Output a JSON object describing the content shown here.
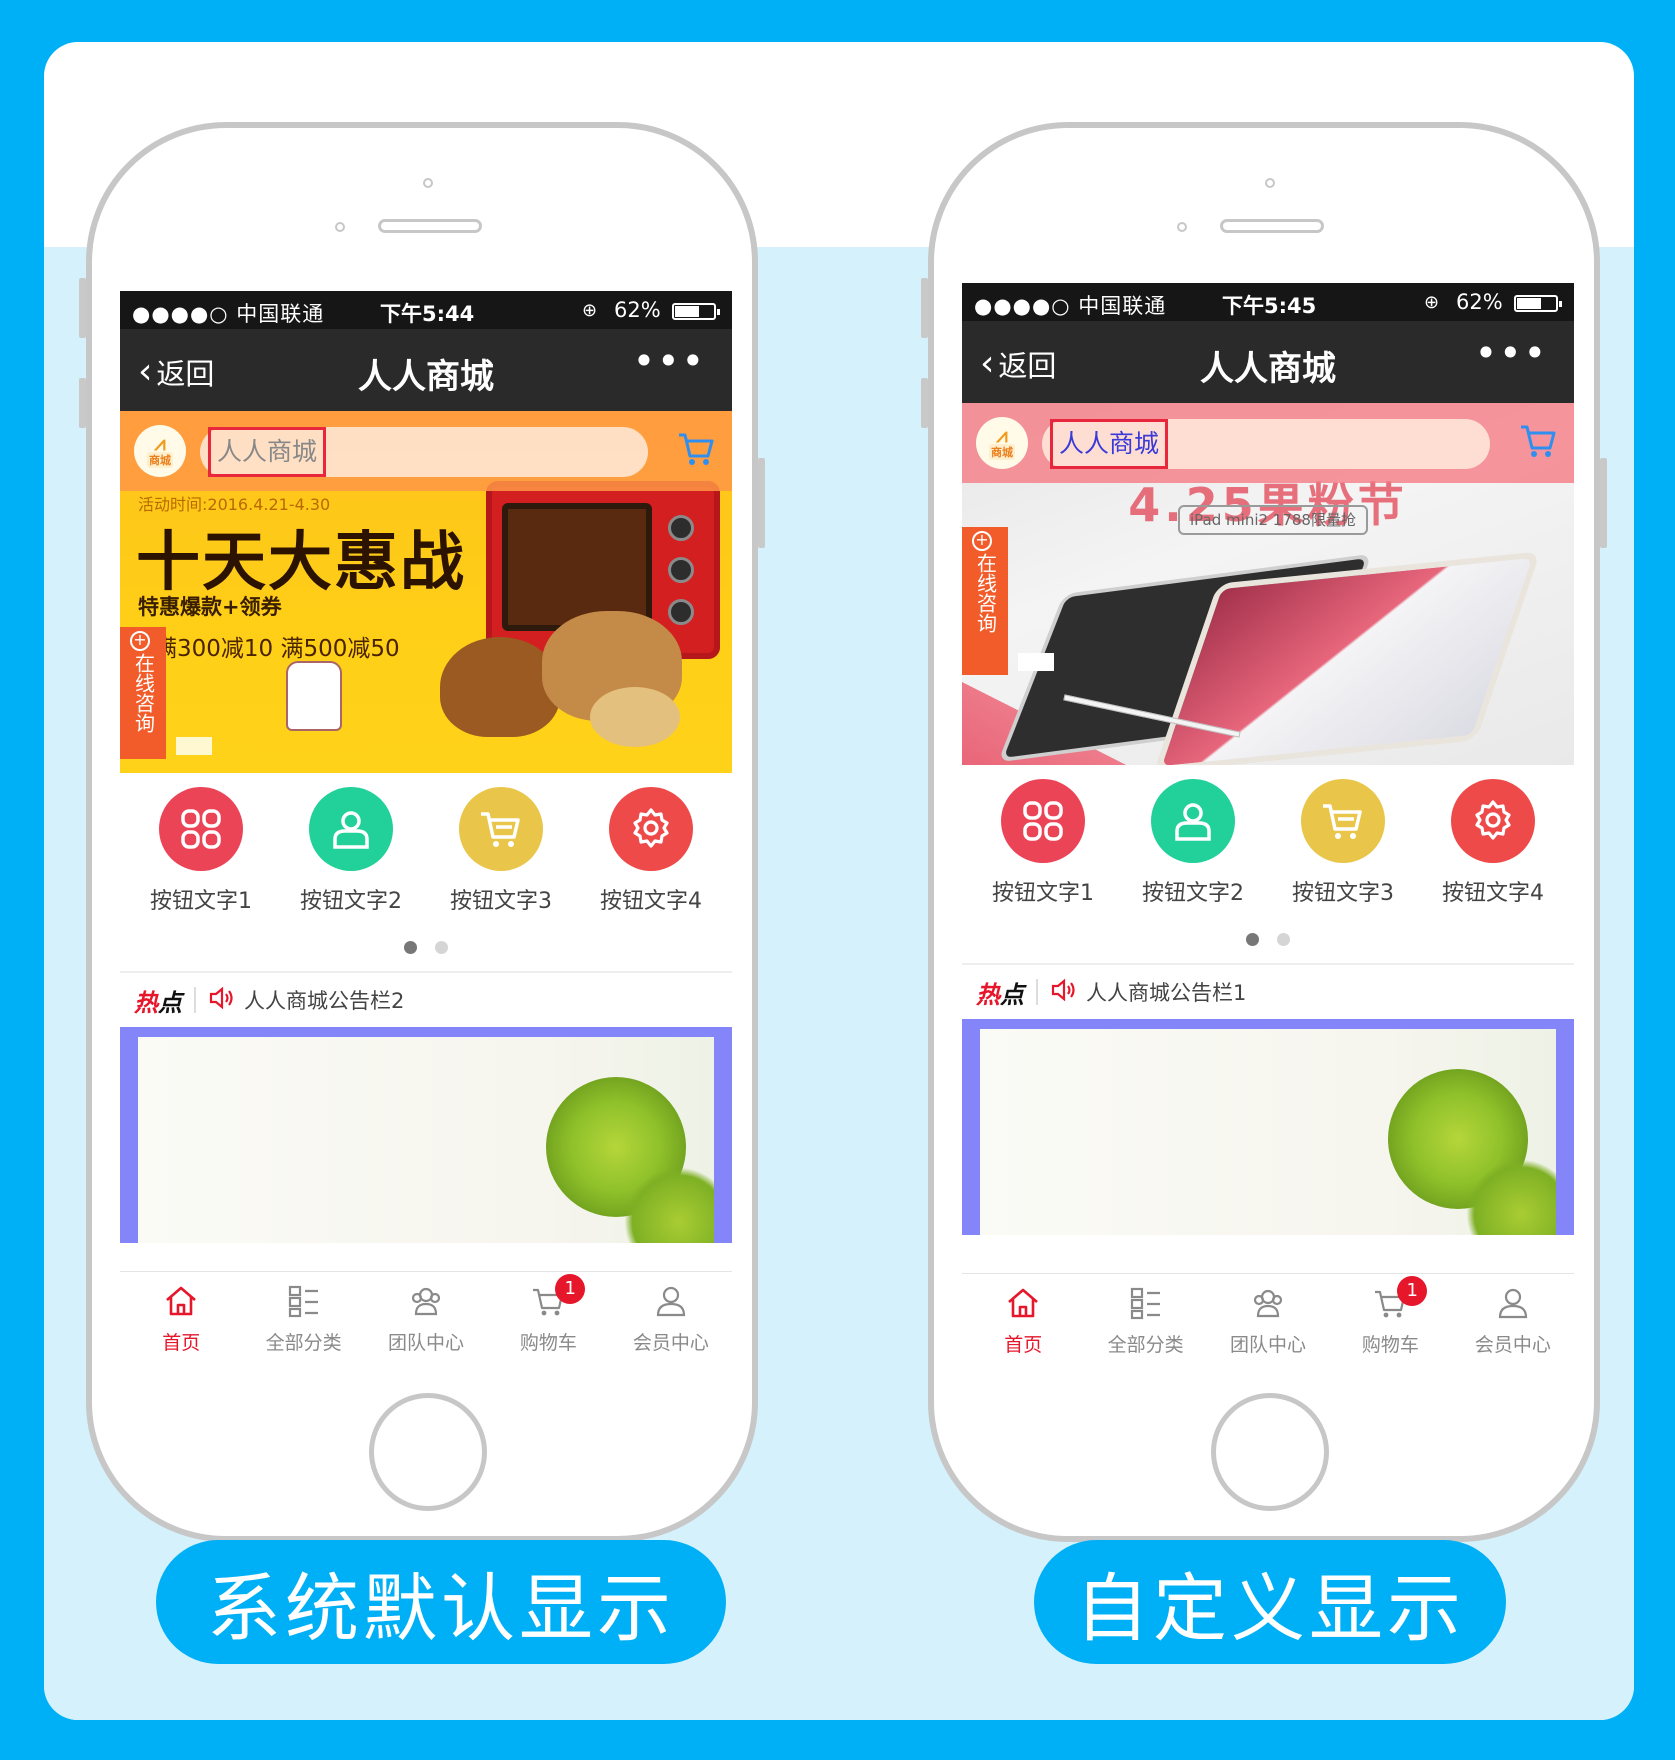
{
  "colors": {
    "frame_blue": "#00b0f6",
    "light_blue": "#d5f1fc",
    "accent_red": "#e6162b",
    "btn1": "#ec4457",
    "btn2": "#22d19a",
    "btn3": "#e9c64a",
    "btn4": "#ee4a4a"
  },
  "phones": [
    {
      "status": {
        "signal": "●●●●○ 中国联通",
        "time": "下午5:44",
        "battery": "62%"
      },
      "nav": {
        "back": "返回",
        "title": "人人商城",
        "more": "•••"
      },
      "search": {
        "text": "人人商城"
      },
      "banner": {
        "date": "活动时间:2016.4.21-4.30",
        "title": "十天大惠战",
        "subtitle": "特惠爆款+领券",
        "offer": "满300减10 满500减50"
      },
      "consult": "在线咨询",
      "buttons": [
        "按钮文字1",
        "按钮文字2",
        "按钮文字3",
        "按钮文字4"
      ],
      "notice": {
        "hot": "热",
        "dian": "点",
        "text": "人人商城公告栏2"
      },
      "tabs": [
        "首页",
        "全部分类",
        "团队中心",
        "购物车",
        "会员中心"
      ],
      "cart_count": "1"
    },
    {
      "status": {
        "signal": "●●●●○ 中国联通",
        "time": "下午5:45",
        "battery": "62%"
      },
      "nav": {
        "back": "返回",
        "title": "人人商城",
        "more": "•••"
      },
      "search": {
        "text": "人人商城"
      },
      "banner": {
        "tagline": "4.25果粉节",
        "badge": "iPad mini2 1788限量抢"
      },
      "consult": "在线咨询",
      "buttons": [
        "按钮文字1",
        "按钮文字2",
        "按钮文字3",
        "按钮文字4"
      ],
      "notice": {
        "hot": "热",
        "dian": "点",
        "text": "人人商城公告栏1"
      },
      "tabs": [
        "首页",
        "全部分类",
        "团队中心",
        "购物车",
        "会员中心"
      ],
      "cart_count": "1"
    }
  ],
  "captions": {
    "left": "系统默认显示",
    "right": "自定义显示"
  }
}
